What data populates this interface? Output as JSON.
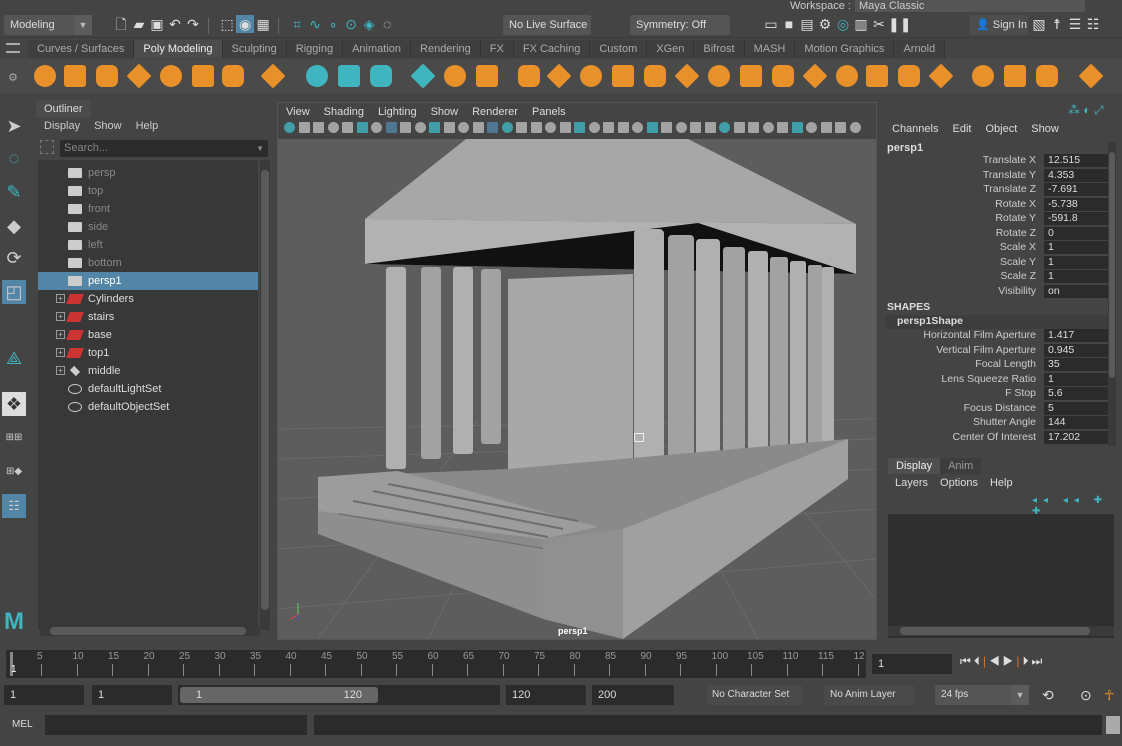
{
  "menubar": {
    "workspace_label": "Workspace :",
    "workspace_value": "Maya Classic"
  },
  "status": {
    "mode": "Modeling",
    "live_surface": "No Live Surface",
    "symmetry": "Symmetry: Off",
    "sign_in": "Sign In"
  },
  "shelf_tabs": [
    "Curves / Surfaces",
    "Poly Modeling",
    "Sculpting",
    "Rigging",
    "Animation",
    "Rendering",
    "FX",
    "FX Caching",
    "Custom",
    "XGen",
    "Bifrost",
    "MASH",
    "Motion Graphics",
    "Arnold"
  ],
  "active_shelf": "Poly Modeling",
  "outliner": {
    "tab": "Outliner",
    "menu": [
      "Display",
      "Show",
      "Help"
    ],
    "search_placeholder": "Search...",
    "items": [
      {
        "label": "persp",
        "type": "camera",
        "state": "dim"
      },
      {
        "label": "top",
        "type": "camera",
        "state": "dim"
      },
      {
        "label": "front",
        "type": "camera",
        "state": "dim"
      },
      {
        "label": "side",
        "type": "camera",
        "state": "dim"
      },
      {
        "label": "left",
        "type": "camera",
        "state": "dim"
      },
      {
        "label": "bottom",
        "type": "camera",
        "state": "dim"
      },
      {
        "label": "persp1",
        "type": "camera",
        "state": "selected"
      },
      {
        "label": "Cylinders",
        "type": "group",
        "state": "normal"
      },
      {
        "label": "stairs",
        "type": "group",
        "state": "normal"
      },
      {
        "label": "base",
        "type": "group",
        "state": "normal"
      },
      {
        "label": "top1",
        "type": "group",
        "state": "normal"
      },
      {
        "label": "middle",
        "type": "group-node",
        "state": "normal"
      },
      {
        "label": "defaultLightSet",
        "type": "set",
        "state": "normal"
      },
      {
        "label": "defaultObjectSet",
        "type": "set",
        "state": "normal"
      }
    ]
  },
  "viewport": {
    "menu": [
      "View",
      "Shading",
      "Lighting",
      "Show",
      "Renderer",
      "Panels"
    ],
    "camera_label": "persp1"
  },
  "channel_box": {
    "menu": [
      "Channels",
      "Edit",
      "Object",
      "Show"
    ],
    "object": "persp1",
    "attributes": [
      {
        "name": "Translate X",
        "value": "12.515"
      },
      {
        "name": "Translate Y",
        "value": "4.353"
      },
      {
        "name": "Translate Z",
        "value": "-7.691"
      },
      {
        "name": "Rotate X",
        "value": "-5.738"
      },
      {
        "name": "Rotate Y",
        "value": "-591.8"
      },
      {
        "name": "Rotate Z",
        "value": "0"
      },
      {
        "name": "Scale X",
        "value": "1"
      },
      {
        "name": "Scale Y",
        "value": "1"
      },
      {
        "name": "Scale Z",
        "value": "1"
      },
      {
        "name": "Visibility",
        "value": "on"
      }
    ],
    "shapes_label": "SHAPES",
    "shape_name": "persp1Shape",
    "shape_attributes": [
      {
        "name": "Horizontal Film Aperture",
        "value": "1.417"
      },
      {
        "name": "Vertical Film Aperture",
        "value": "0.945"
      },
      {
        "name": "Focal Length",
        "value": "35"
      },
      {
        "name": "Lens Squeeze Ratio",
        "value": "1"
      },
      {
        "name": "F Stop",
        "value": "5.6"
      },
      {
        "name": "Focus Distance",
        "value": "5"
      },
      {
        "name": "Shutter Angle",
        "value": "144"
      },
      {
        "name": "Center Of Interest",
        "value": "17.202"
      }
    ]
  },
  "layer_editor": {
    "tabs": [
      "Display",
      "Anim"
    ],
    "menu": [
      "Layers",
      "Options",
      "Help"
    ]
  },
  "timeline": {
    "ticks": [
      "5",
      "10",
      "15",
      "20",
      "25",
      "30",
      "35",
      "40",
      "45",
      "50",
      "55",
      "60",
      "65",
      "70",
      "75",
      "80",
      "85",
      "90",
      "95",
      "100",
      "105",
      "110",
      "115",
      "12"
    ],
    "current_label": "1",
    "current_frame": "1"
  },
  "range": {
    "start": "1",
    "anim_start": "1",
    "slider_start": "1",
    "slider_end": "120",
    "end": "120",
    "anim_end": "200",
    "character_set": "No Character Set",
    "anim_layer": "No Anim Layer",
    "fps": "24 fps"
  },
  "command_line": {
    "label": "MEL"
  },
  "colors": {
    "accent": "#5285a6",
    "shelf_icon": "#e8902a",
    "teal": "#3fb5c0",
    "playhead": "#e07020"
  }
}
